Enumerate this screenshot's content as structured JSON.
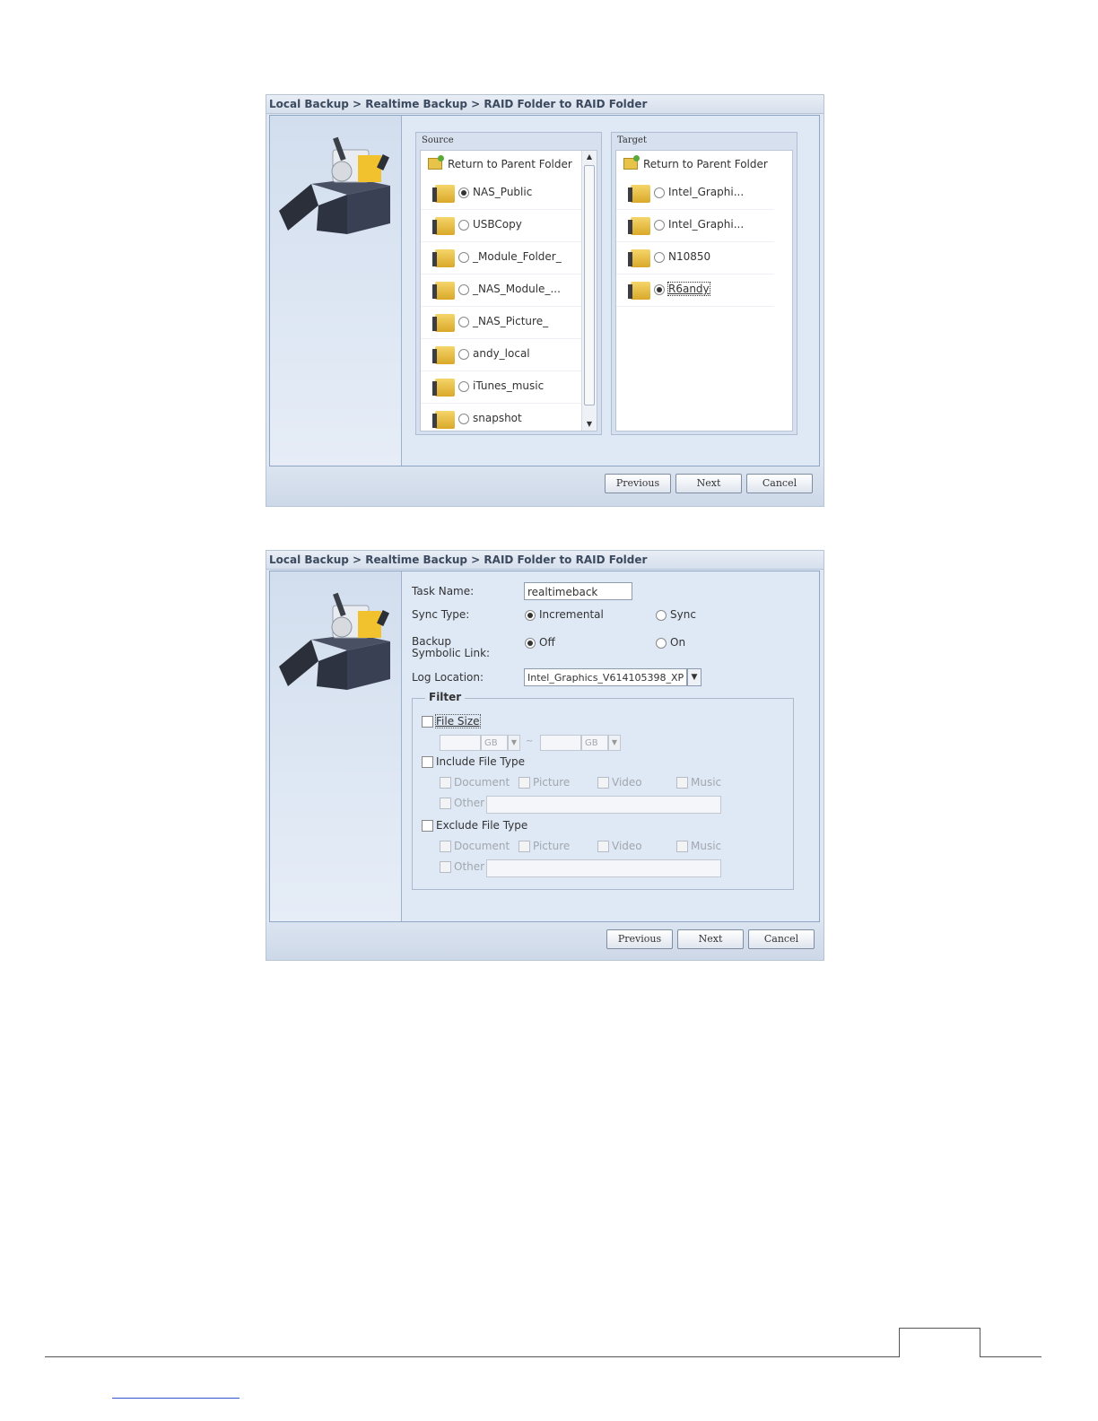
{
  "dialog1": {
    "title": "Local Backup > Realtime Backup > RAID Folder to RAID Folder",
    "source": {
      "header": "Source",
      "parent_label": "Return to Parent Folder",
      "items": [
        {
          "label": "NAS_Public",
          "selected": true
        },
        {
          "label": "USBCopy",
          "selected": false
        },
        {
          "label": "_Module_Folder_",
          "selected": false
        },
        {
          "label": "_NAS_Module_...",
          "selected": false
        },
        {
          "label": "_NAS_Picture_",
          "selected": false
        },
        {
          "label": "andy_local",
          "selected": false
        },
        {
          "label": "iTunes_music",
          "selected": false
        },
        {
          "label": "snapshot",
          "selected": false
        }
      ]
    },
    "target": {
      "header": "Target",
      "parent_label": "Return to Parent Folder",
      "items": [
        {
          "label": "Intel_Graphi...",
          "selected": false
        },
        {
          "label": "Intel_Graphi...",
          "selected": false
        },
        {
          "label": "N10850",
          "selected": false
        },
        {
          "label": "R6andy",
          "selected": true
        }
      ]
    },
    "buttons": {
      "previous": "Previous",
      "next": "Next",
      "cancel": "Cancel"
    }
  },
  "dialog2": {
    "title": "Local Backup > Realtime Backup > RAID Folder to RAID Folder",
    "task_name_label": "Task Name:",
    "task_name_value": "realtimeback",
    "sync_type_label": "Sync Type:",
    "sync_incremental": "Incremental",
    "sync_sync": "Sync",
    "symlink_label": "Backup Symbolic Link:",
    "symlink_off": "Off",
    "symlink_on": "On",
    "log_location_label": "Log Location:",
    "log_location_value": "Intel_Graphics_V614105398_XP",
    "filter": {
      "legend": "Filter",
      "file_size": "File Size",
      "unit1": "GB",
      "unit2": "GB",
      "include": "Include File Type",
      "exclude": "Exclude File Type",
      "types": {
        "document": "Document",
        "picture": "Picture",
        "video": "Video",
        "music": "Music",
        "other": "Other"
      }
    },
    "buttons": {
      "previous": "Previous",
      "next": "Next",
      "cancel": "Cancel"
    }
  }
}
